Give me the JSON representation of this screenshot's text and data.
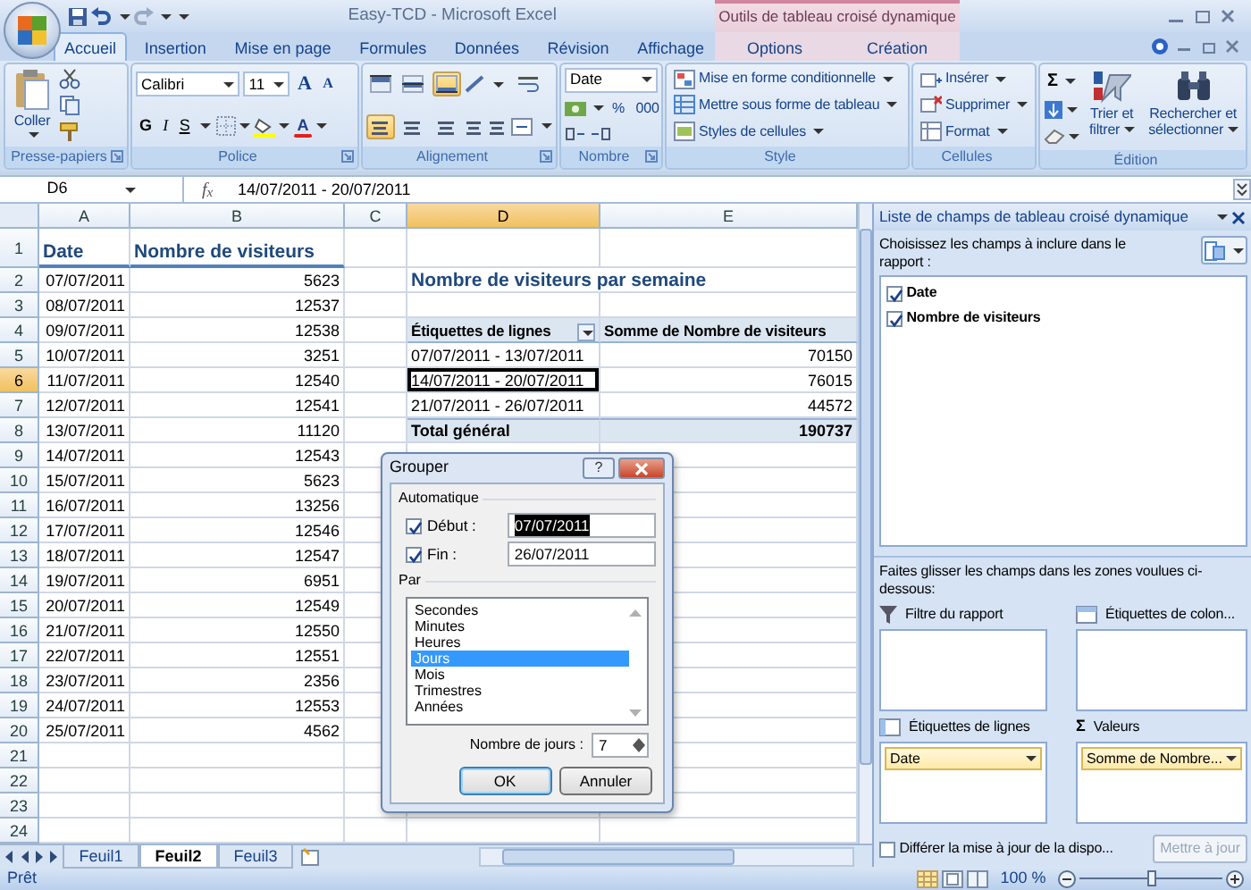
{
  "window": {
    "title": "Easy-TCD - Microsoft Excel",
    "context_group": "Outils de tableau croisé dynamique"
  },
  "ribbon_tabs": [
    {
      "label": "Accueil",
      "selected": true,
      "kind": "standard"
    },
    {
      "label": "Insertion",
      "selected": false,
      "kind": "standard"
    },
    {
      "label": "Mise en page",
      "selected": false,
      "kind": "standard"
    },
    {
      "label": "Formules",
      "selected": false,
      "kind": "standard"
    },
    {
      "label": "Données",
      "selected": false,
      "kind": "standard"
    },
    {
      "label": "Révision",
      "selected": false,
      "kind": "standard"
    },
    {
      "label": "Affichage",
      "selected": false,
      "kind": "standard"
    },
    {
      "label": "Options",
      "selected": false,
      "kind": "contextual"
    },
    {
      "label": "Création",
      "selected": false,
      "kind": "contextual"
    }
  ],
  "ribbon": {
    "clipboard": {
      "label": "Presse-papiers",
      "paste": "Coller",
      "launcher": true
    },
    "font": {
      "label": "Police",
      "font_name": "Calibri",
      "font_size": "11",
      "grow": "A",
      "shrink": "A",
      "bold": "G",
      "italic": "I",
      "underline": "S",
      "font_color": "A",
      "launcher": true
    },
    "alignment": {
      "label": "Alignement",
      "launcher": true,
      "vertical": [
        {
          "selected": false
        },
        {
          "selected": false
        },
        {
          "selected": true
        }
      ],
      "horizontal": [
        {
          "selected": true
        },
        {
          "selected": false
        },
        {
          "selected": false
        }
      ]
    },
    "number": {
      "label": "Nombre",
      "format": "Date",
      "percent": "%",
      "thousands": "000",
      "launcher": true
    },
    "styles": {
      "label": "Style",
      "items": [
        "Mise en forme conditionnelle",
        "Mettre sous forme de tableau",
        "Styles de cellules"
      ]
    },
    "cells": {
      "label": "Cellules",
      "items": [
        "Insérer",
        "Supprimer",
        "Format"
      ]
    },
    "editing": {
      "label": "Édition",
      "sum": "Σ",
      "sort": "Trier et filtrer",
      "find": "Rechercher et sélectionner"
    }
  },
  "formula_bar": {
    "name_box": "D6",
    "function_label": "f$_{x}$",
    "formula": "14/07/2011 - 20/07/2011"
  },
  "sheet": {
    "columns": [
      {
        "label": "A",
        "selected": false
      },
      {
        "label": "B",
        "selected": false
      },
      {
        "label": "C",
        "selected": false
      },
      {
        "label": "D",
        "selected": true
      },
      {
        "label": "E",
        "selected": false
      }
    ],
    "rows": [
      {
        "label": "1",
        "selected": false,
        "cells": {
          "col_a": {
            "text": "Date",
            "kind": "heading"
          },
          "col_b": {
            "text": "Nombre de visiteurs",
            "kind": "heading"
          }
        }
      },
      {
        "label": "2",
        "selected": false,
        "cells": {
          "col_a": {
            "text": "07/07/2011",
            "kind": "date"
          },
          "col_b": {
            "text": "5623",
            "kind": "number"
          },
          "col_d": {
            "text": "Nombre de visiteurs par semaine",
            "kind": "pivot_title"
          }
        }
      },
      {
        "label": "3",
        "selected": false,
        "cells": {
          "col_a": {
            "text": "08/07/2011",
            "kind": "date"
          },
          "col_b": {
            "text": "12537",
            "kind": "number"
          }
        }
      },
      {
        "label": "4",
        "selected": false,
        "cells": {
          "col_a": {
            "text": "09/07/2011",
            "kind": "date"
          },
          "col_b": {
            "text": "12538",
            "kind": "number"
          },
          "col_d": {
            "text": "Étiquettes de lignes",
            "kind": "pivot_header",
            "filter_button": true
          },
          "col_e": {
            "text": "Somme de Nombre de visiteurs",
            "kind": "pivot_header"
          }
        }
      },
      {
        "label": "5",
        "selected": false,
        "cells": {
          "col_a": {
            "text": "10/07/2011",
            "kind": "date"
          },
          "col_b": {
            "text": "3251",
            "kind": "number"
          },
          "col_d": {
            "text": "07/07/2011 - 13/07/2011",
            "kind": "pivot_label"
          },
          "col_e": {
            "text": "70150",
            "kind": "pivot_value"
          }
        }
      },
      {
        "label": "6",
        "selected": true,
        "cells": {
          "col_a": {
            "text": "11/07/2011",
            "kind": "date"
          },
          "col_b": {
            "text": "12540",
            "kind": "number"
          },
          "col_d": {
            "text": "14/07/2011 - 20/07/2011",
            "kind": "pivot_label"
          },
          "col_e": {
            "text": "76015",
            "kind": "pivot_value"
          }
        }
      },
      {
        "label": "7",
        "selected": false,
        "cells": {
          "col_a": {
            "text": "12/07/2011",
            "kind": "date"
          },
          "col_b": {
            "text": "12541",
            "kind": "number"
          },
          "col_d": {
            "text": "21/07/2011 - 26/07/2011",
            "kind": "pivot_label"
          },
          "col_e": {
            "text": "44572",
            "kind": "pivot_value"
          }
        }
      },
      {
        "label": "8",
        "selected": false,
        "cells": {
          "col_a": {
            "text": "13/07/2011",
            "kind": "date"
          },
          "col_b": {
            "text": "11120",
            "kind": "number"
          },
          "col_d": {
            "text": "Total général",
            "kind": "total_label"
          },
          "col_e": {
            "text": "190737",
            "kind": "total_value"
          }
        }
      },
      {
        "label": "9",
        "selected": false,
        "cells": {
          "col_a": {
            "text": "14/07/2011",
            "kind": "date"
          },
          "col_b": {
            "text": "12543",
            "kind": "number"
          }
        }
      },
      {
        "label": "10",
        "selected": false,
        "cells": {
          "col_a": {
            "text": "15/07/2011",
            "kind": "date"
          },
          "col_b": {
            "text": "5623",
            "kind": "number"
          }
        }
      },
      {
        "label": "11",
        "selected": false,
        "cells": {
          "col_a": {
            "text": "16/07/2011",
            "kind": "date"
          },
          "col_b": {
            "text": "13256",
            "kind": "number"
          }
        }
      },
      {
        "label": "12",
        "selected": false,
        "cells": {
          "col_a": {
            "text": "17/07/2011",
            "kind": "date"
          },
          "col_b": {
            "text": "12546",
            "kind": "number"
          }
        }
      },
      {
        "label": "13",
        "selected": false,
        "cells": {
          "col_a": {
            "text": "18/07/2011",
            "kind": "date"
          },
          "col_b": {
            "text": "12547",
            "kind": "number"
          }
        }
      },
      {
        "label": "14",
        "selected": false,
        "cells": {
          "col_a": {
            "text": "19/07/2011",
            "kind": "date"
          },
          "col_b": {
            "text": "6951",
            "kind": "number"
          }
        }
      },
      {
        "label": "15",
        "selected": false,
        "cells": {
          "col_a": {
            "text": "20/07/2011",
            "kind": "date"
          },
          "col_b": {
            "text": "12549",
            "kind": "number"
          }
        }
      },
      {
        "label": "16",
        "selected": false,
        "cells": {
          "col_a": {
            "text": "21/07/2011",
            "kind": "date"
          },
          "col_b": {
            "text": "12550",
            "kind": "number"
          }
        }
      },
      {
        "label": "17",
        "selected": false,
        "cells": {
          "col_a": {
            "text": "22/07/2011",
            "kind": "date"
          },
          "col_b": {
            "text": "12551",
            "kind": "number"
          }
        }
      },
      {
        "label": "18",
        "selected": false,
        "cells": {
          "col_a": {
            "text": "23/07/2011",
            "kind": "date"
          },
          "col_b": {
            "text": "2356",
            "kind": "number"
          }
        }
      },
      {
        "label": "19",
        "selected": false,
        "cells": {
          "col_a": {
            "text": "24/07/2011",
            "kind": "date"
          },
          "col_b": {
            "text": "12553",
            "kind": "number"
          }
        }
      },
      {
        "label": "20",
        "selected": false,
        "cells": {
          "col_a": {
            "text": "25/07/2011",
            "kind": "date"
          },
          "col_b": {
            "text": "4562",
            "kind": "number"
          }
        }
      },
      {
        "label": "21",
        "selected": false,
        "cells": {}
      },
      {
        "label": "22",
        "selected": false,
        "cells": {}
      },
      {
        "label": "23",
        "selected": false,
        "cells": {}
      },
      {
        "label": "24",
        "selected": false,
        "cells": {}
      }
    ]
  },
  "group_dialog": {
    "title": "Grouper",
    "help": "?",
    "auto_label": "Automatique",
    "start": {
      "label": "Début :",
      "checked": true,
      "value": "07/07/2011",
      "text_selected": true
    },
    "end": {
      "label": "Fin :",
      "checked": true,
      "value": "26/07/2011",
      "text_selected": false
    },
    "by_label": "Par",
    "units": [
      {
        "label": "Secondes",
        "selected": false
      },
      {
        "label": "Minutes",
        "selected": false
      },
      {
        "label": "Heures",
        "selected": false
      },
      {
        "label": "Jours",
        "selected": true
      },
      {
        "label": "Mois",
        "selected": false
      },
      {
        "label": "Trimestres",
        "selected": false
      },
      {
        "label": "Années",
        "selected": false
      }
    ],
    "count_label": "Nombre de jours :",
    "count_value": "7",
    "buttons": [
      {
        "label": "OK",
        "kind": "default"
      },
      {
        "label": "Annuler",
        "kind": "cancel"
      }
    ]
  },
  "field_list": {
    "title": "Liste de champs de tableau croisé dynamique",
    "instructions": "Choisissez les champs à inclure dans le rapport :",
    "fields": [
      {
        "label": "Date",
        "checked": true
      },
      {
        "label": "Nombre de visiteurs",
        "checked": true
      }
    ],
    "drag_hint": "Faites glisser les champs dans les zones voulues ci-dessous:",
    "areas": [
      {
        "label": "Filtre du rapport",
        "kind": "filter"
      },
      {
        "label": "Étiquettes de colon...",
        "kind": "columns"
      },
      {
        "label": "Étiquettes de lignes",
        "kind": "rows",
        "items": [
          "Date"
        ]
      },
      {
        "label": "Valeurs",
        "kind": "values",
        "symbol": "Σ",
        "items": [
          "Somme de Nombre..."
        ]
      }
    ],
    "defer": {
      "label": "Différer la mise à jour de la dispo...",
      "checked": false
    },
    "update_button": {
      "label": "Mettre à jour",
      "disabled": true
    }
  },
  "sheet_tabs": [
    {
      "label": "Feuil1",
      "selected": false
    },
    {
      "label": "Feuil2",
      "selected": true
    },
    {
      "label": "Feuil3",
      "selected": false
    }
  ],
  "status_bar": {
    "text": "Prêt",
    "zoom": {
      "label": "100 %",
      "level": 0.5
    }
  }
}
